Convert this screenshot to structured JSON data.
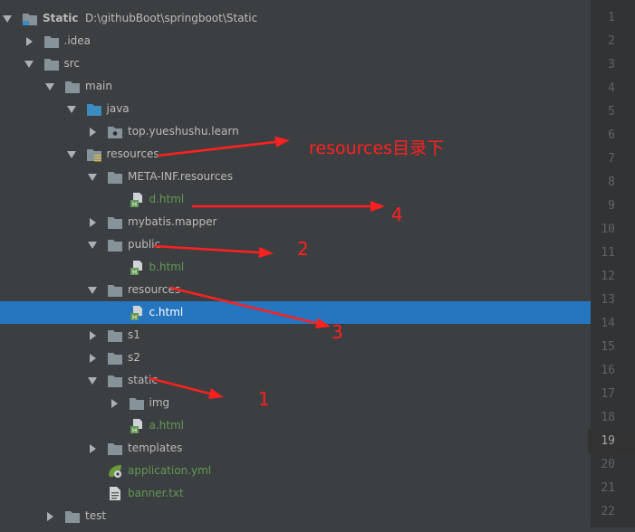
{
  "project": {
    "name": "Static",
    "path": "D:\\githubBoot\\springboot\\Static"
  },
  "tree": [
    {
      "id": "static-root",
      "label": "Static",
      "indent": 0,
      "arrow": "down",
      "icon": "module-folder",
      "color": "#bbbbbb"
    },
    {
      "id": "idea",
      "label": ".idea",
      "indent": 1,
      "arrow": "right",
      "icon": "folder",
      "color": "#bbbbbb"
    },
    {
      "id": "src",
      "label": "src",
      "indent": 1,
      "arrow": "down",
      "icon": "folder",
      "color": "#bbbbbb"
    },
    {
      "id": "main",
      "label": "main",
      "indent": 2,
      "arrow": "down",
      "icon": "folder",
      "color": "#bbbbbb"
    },
    {
      "id": "java",
      "label": "java",
      "indent": 3,
      "arrow": "down",
      "icon": "source-folder",
      "color": "#bbbbbb"
    },
    {
      "id": "top-yueshushu-learn",
      "label": "top.yueshushu.learn",
      "indent": 4,
      "arrow": "right",
      "icon": "package",
      "color": "#bbbbbb"
    },
    {
      "id": "resources-root",
      "label": "resources",
      "indent": 3,
      "arrow": "down",
      "icon": "resource-folder",
      "color": "#bbbbbb"
    },
    {
      "id": "meta-inf-resources",
      "label": "META-INF.resources",
      "indent": 4,
      "arrow": "down",
      "icon": "folder",
      "color": "#bbbbbb"
    },
    {
      "id": "d-html",
      "label": "d.html",
      "indent": 5,
      "arrow": "none",
      "icon": "html-file",
      "color": "#629755"
    },
    {
      "id": "mybatis-mapper",
      "label": "mybatis.mapper",
      "indent": 4,
      "arrow": "right",
      "icon": "folder",
      "color": "#bbbbbb"
    },
    {
      "id": "public",
      "label": "public",
      "indent": 4,
      "arrow": "down",
      "icon": "folder",
      "color": "#bbbbbb"
    },
    {
      "id": "b-html",
      "label": "b.html",
      "indent": 5,
      "arrow": "none",
      "icon": "html-file",
      "color": "#629755"
    },
    {
      "id": "resources-sub",
      "label": "resources",
      "indent": 4,
      "arrow": "down",
      "icon": "folder",
      "color": "#bbbbbb"
    },
    {
      "id": "c-html",
      "label": "c.html",
      "indent": 5,
      "arrow": "none",
      "icon": "html-file",
      "color": "#ffffff",
      "selected": true
    },
    {
      "id": "s1",
      "label": "s1",
      "indent": 4,
      "arrow": "right",
      "icon": "folder",
      "color": "#bbbbbb"
    },
    {
      "id": "s2",
      "label": "s2",
      "indent": 4,
      "arrow": "right",
      "icon": "folder",
      "color": "#bbbbbb"
    },
    {
      "id": "static",
      "label": "static",
      "indent": 4,
      "arrow": "down",
      "icon": "folder",
      "color": "#bbbbbb"
    },
    {
      "id": "img",
      "label": "img",
      "indent": 5,
      "arrow": "right",
      "icon": "folder",
      "color": "#bbbbbb"
    },
    {
      "id": "a-html",
      "label": "a.html",
      "indent": 5,
      "arrow": "none",
      "icon": "html-file",
      "color": "#629755"
    },
    {
      "id": "templates",
      "label": "templates",
      "indent": 4,
      "arrow": "right",
      "icon": "folder",
      "color": "#bbbbbb"
    },
    {
      "id": "application-yml",
      "label": "application.yml",
      "indent": 4,
      "arrow": "none",
      "icon": "spring-config-file",
      "color": "#629755"
    },
    {
      "id": "banner-txt",
      "label": "banner.txt",
      "indent": 4,
      "arrow": "none",
      "icon": "text-file",
      "color": "#629755"
    },
    {
      "id": "test",
      "label": "test",
      "indent": 2,
      "arrow": "right",
      "icon": "folder",
      "color": "#bbbbbb"
    }
  ],
  "gutter": {
    "line_numbers": [
      "1",
      "2",
      "3",
      "4",
      "5",
      "6",
      "7",
      "8",
      "9",
      "10",
      "11",
      "12",
      "13",
      "14",
      "15",
      "16",
      "17",
      "18",
      "19",
      "20",
      "21",
      "22"
    ],
    "current_line": "19"
  },
  "annotations": {
    "color": "#ff2020",
    "resources_note": "resources目录下",
    "labels": [
      "4",
      "2",
      "3",
      "1"
    ]
  },
  "colors": {
    "background": "#3c3f41",
    "selection": "#2675bf",
    "folder": "#87939a",
    "source_folder": "#3b8cc1",
    "html_green": "#629755"
  }
}
